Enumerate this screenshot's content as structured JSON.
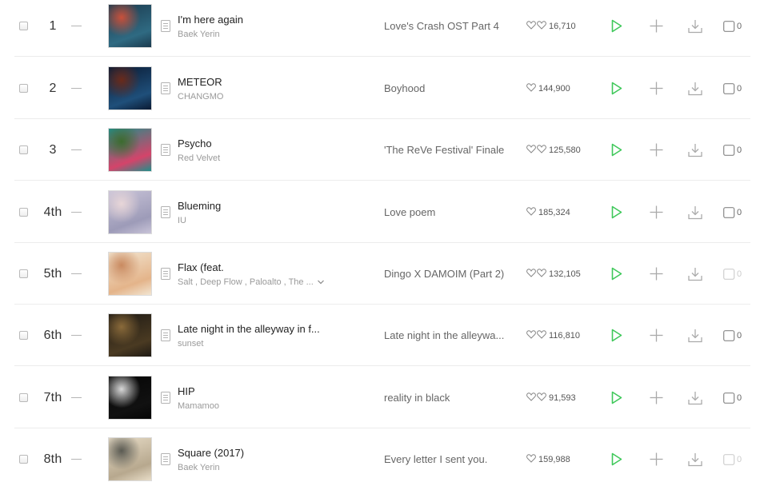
{
  "colors": {
    "play_green": "#3fc85a",
    "divider": "#ececec",
    "icon_gray": "#aaaaaa"
  },
  "icons": {
    "checkbox": "checkbox-icon",
    "rank_change": "no-change-dash-icon",
    "lyrics": "lyrics-document-icon",
    "like": "heart-outline-icon",
    "play": "play-triangle-icon",
    "add": "plus-icon",
    "download": "download-icon",
    "music_video": "music-video-icon",
    "artist_more": "chevron-down-icon"
  },
  "rows": [
    {
      "rank": "1",
      "title": "I'm here again",
      "artist": "Baek Yerin",
      "album": "Love's Crash OST Part 4",
      "likes": "16,710",
      "likes_double": true,
      "mv_count": "0",
      "mv_enabled": true,
      "artist_more": false,
      "art": [
        "#1b3a4e",
        "#2f6a82",
        "#c9503a"
      ]
    },
    {
      "rank": "2",
      "title": "METEOR",
      "artist": "CHANGMO",
      "album": "Boyhood",
      "likes": "144,900",
      "likes_double": false,
      "mv_count": "0",
      "mv_enabled": true,
      "artist_more": false,
      "art": [
        "#0a1a33",
        "#1f4f7a",
        "#6a2a1a"
      ]
    },
    {
      "rank": "3",
      "title": "Psycho",
      "artist": "Red Velvet",
      "album": "'The ReVe Festival' Finale",
      "likes": "125,580",
      "likes_double": true,
      "mv_count": "0",
      "mv_enabled": true,
      "artist_more": false,
      "art": [
        "#1f8f8a",
        "#d4446a",
        "#3c6b2e"
      ]
    },
    {
      "rank": "4th",
      "title": "Blueming",
      "artist": "IU",
      "album": "Love poem",
      "likes": "185,324",
      "likes_double": false,
      "mv_count": "0",
      "mv_enabled": true,
      "artist_more": false,
      "art": [
        "#c9c4d8",
        "#9d9bb8",
        "#e8d6d8"
      ]
    },
    {
      "rank": "5th",
      "title": "Flax (feat.",
      "artist": "Salt , Deep Flow , Paloalto , The ...",
      "album": "Dingo X DAMOIM (Part 2)",
      "likes": "132,105",
      "likes_double": true,
      "mv_count": "0",
      "mv_enabled": false,
      "artist_more": true,
      "art": [
        "#f2e6d2",
        "#e4b48a",
        "#c98a60"
      ]
    },
    {
      "rank": "6th",
      "title": "Late night in the alleyway in f...",
      "artist": "sunset",
      "album": "Late night in the alleywa...",
      "likes": "116,810",
      "likes_double": true,
      "mv_count": "0",
      "mv_enabled": true,
      "artist_more": false,
      "art": [
        "#1e1a14",
        "#4a3a22",
        "#8a6a3a"
      ]
    },
    {
      "rank": "7th",
      "title": "HIP",
      "artist": "Mamamoo",
      "album": "reality in black",
      "likes": "91,593",
      "likes_double": true,
      "mv_count": "0",
      "mv_enabled": true,
      "artist_more": false,
      "art": [
        "#050505",
        "#111111",
        "#d8d8d8"
      ]
    },
    {
      "rank": "8th",
      "title": "Square (2017)",
      "artist": "Baek Yerin",
      "album": "Every letter I sent you.",
      "likes": "159,988",
      "likes_double": false,
      "mv_count": "0",
      "mv_enabled": false,
      "artist_more": false,
      "art": [
        "#e8ddc8",
        "#b7a88e",
        "#5a5a52"
      ]
    }
  ]
}
